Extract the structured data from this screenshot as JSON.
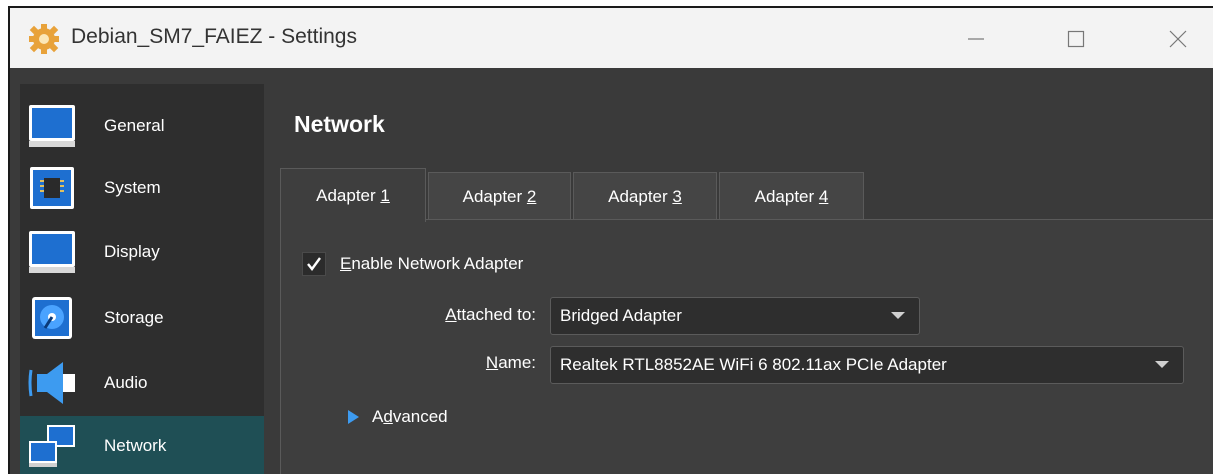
{
  "window": {
    "title": "Debian_SM7_FAIEZ - Settings",
    "controls": [
      "minimize-icon",
      "maximize-icon",
      "close-icon"
    ]
  },
  "sidebar": {
    "items": [
      {
        "label": "General",
        "icon": "monitor-icon",
        "active": false
      },
      {
        "label": "System",
        "icon": "chip-icon",
        "active": false
      },
      {
        "label": "Display",
        "icon": "display-icon",
        "active": false
      },
      {
        "label": "Storage",
        "icon": "disk-icon",
        "active": false
      },
      {
        "label": "Audio",
        "icon": "speaker-icon",
        "active": false
      },
      {
        "label": "Network",
        "icon": "network-icon",
        "active": true
      }
    ]
  },
  "main": {
    "heading": "Network",
    "tabs": [
      {
        "prefix": "Adapter ",
        "mnemonic": "1",
        "active": true
      },
      {
        "prefix": "Adapter ",
        "mnemonic": "2",
        "active": false
      },
      {
        "prefix": "Adapter ",
        "mnemonic": "3",
        "active": false
      },
      {
        "prefix": "Adapter ",
        "mnemonic": "4",
        "active": false
      }
    ],
    "enable_adapter": {
      "mnemonic": "E",
      "label_rest": "nable Network Adapter",
      "checked": true
    },
    "attached_to": {
      "mnemonic": "A",
      "label_rest": "ttached to:",
      "value": "Bridged Adapter"
    },
    "name": {
      "mnemonic": "N",
      "label_rest": "ame:",
      "value": "Realtek RTL8852AE WiFi 6 802.11ax PCIe Adapter"
    },
    "advanced": {
      "prefix": "A",
      "mnemonic": "d",
      "rest": "vanced"
    }
  },
  "colors": {
    "accent": "#3d9bf0",
    "active_sidebar": "#1f4f55",
    "panel_bg": "#3a3a3a",
    "titlebar_bg": "#f3f3f3"
  }
}
